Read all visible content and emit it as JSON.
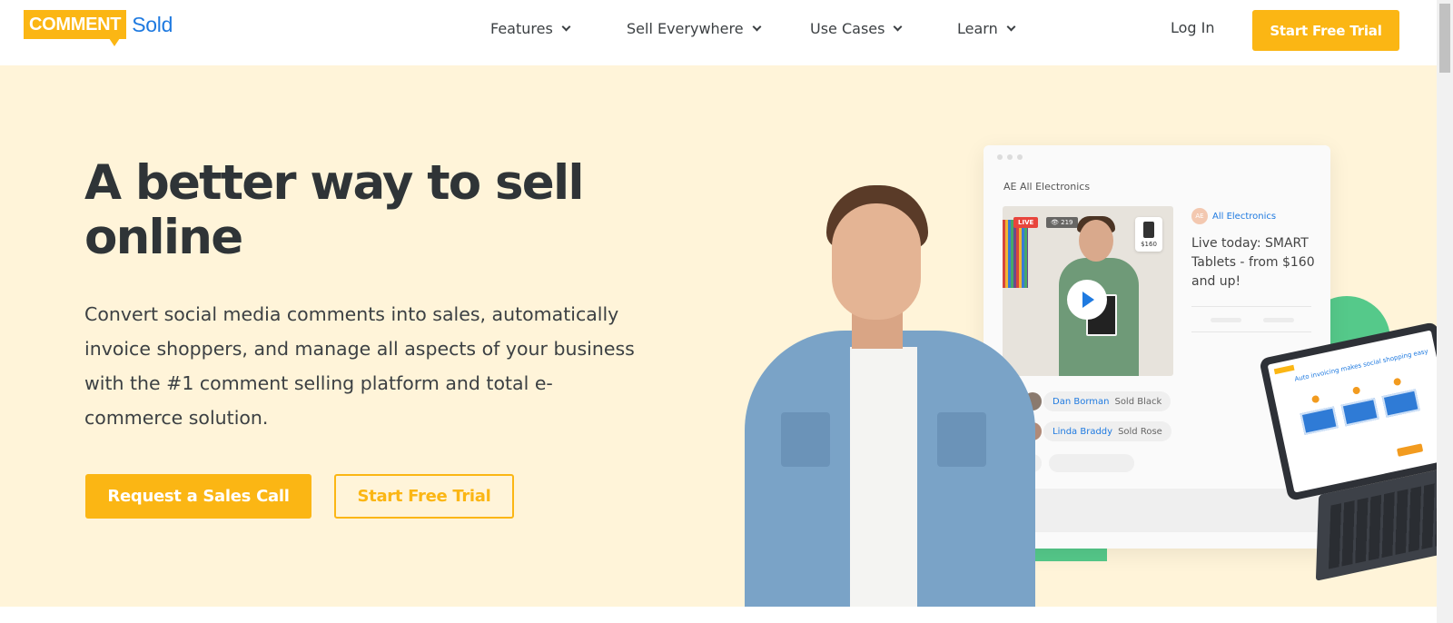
{
  "logo": {
    "comment": "COMMENT",
    "sold": "Sold"
  },
  "nav": {
    "items": [
      {
        "label": "Features"
      },
      {
        "label": "Sell Everywhere"
      },
      {
        "label": "Use Cases"
      },
      {
        "label": "Learn"
      }
    ],
    "login_label": "Log In",
    "trial_label": "Start Free Trial"
  },
  "hero": {
    "title": "A better way to sell online",
    "subtitle": "Convert social media comments into sales, automatically invoice shoppers, and manage all aspects of your business with the #1 comment selling platform and total e-commerce solution.",
    "primary_cta": "Request a Sales Call",
    "secondary_cta": "Start Free Trial"
  },
  "illustration": {
    "store_name": "AE All Electronics",
    "live_badge": "LIVE",
    "viewer_count": "219",
    "price_tag": "$160",
    "seller_initials": "AE",
    "seller_name": "All Electronics",
    "live_message": "Live today: SMART Tablets - from $160 and up!",
    "comments": [
      {
        "name": "Dan Borman",
        "action": "Sold Black"
      },
      {
        "name": "Linda Braddy",
        "action": "Sold Rose"
      }
    ],
    "tablet_headline": "Auto invoicing makes social shopping easy"
  },
  "colors": {
    "accent": "#fbb614",
    "brand_blue": "#1f7ae0",
    "hero_bg": "#fff4d9",
    "green": "#55c98a"
  }
}
